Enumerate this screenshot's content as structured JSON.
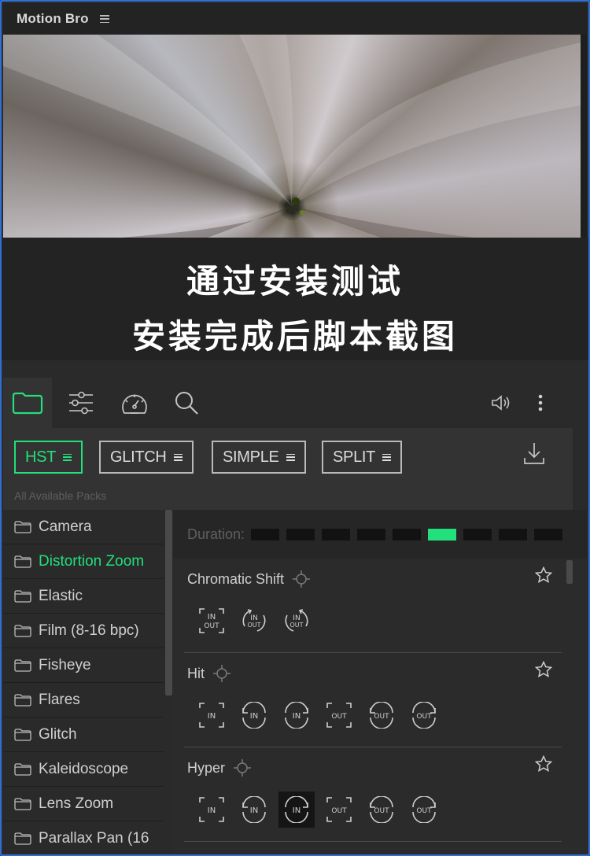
{
  "window": {
    "title": "Motion Bro"
  },
  "banner": {
    "line1": "通过安装测试",
    "line2": "安装完成后脚本截图"
  },
  "toolbar": {
    "tools": [
      "folder-icon",
      "sliders-icon",
      "speedometer-icon",
      "search-icon"
    ],
    "right": [
      "speaker-icon",
      "more-vertical-icon"
    ]
  },
  "packs": {
    "items": [
      {
        "label": "HST",
        "active": true
      },
      {
        "label": "GLITCH",
        "active": false
      },
      {
        "label": "SIMPLE",
        "active": false
      },
      {
        "label": "SPLIT",
        "active": false
      }
    ],
    "caption": "All Available Packs"
  },
  "sidebar": {
    "items": [
      {
        "label": "Camera"
      },
      {
        "label": "Distortion Zoom",
        "active": true
      },
      {
        "label": "Elastic"
      },
      {
        "label": "Film (8-16 bpc)"
      },
      {
        "label": "Fisheye"
      },
      {
        "label": "Flares"
      },
      {
        "label": "Glitch"
      },
      {
        "label": "Kaleidoscope"
      },
      {
        "label": "Lens Zoom"
      },
      {
        "label": "Parallax Pan (16"
      }
    ]
  },
  "duration": {
    "label": "Duration:",
    "segments": 9,
    "selected_index": 5
  },
  "effects": [
    {
      "name": "Chromatic Shift",
      "variants": [
        "IN OUT",
        "IN OUT",
        "IN OUT"
      ]
    },
    {
      "name": "Hit",
      "variants": [
        "IN",
        "IN",
        "IN",
        "OUT",
        "OUT",
        "OUT"
      ]
    },
    {
      "name": "Hyper",
      "variants": [
        "IN",
        "IN",
        "IN",
        "OUT",
        "OUT",
        "OUT"
      ],
      "selected_variant": 2
    }
  ],
  "colors": {
    "accent": "#22e07b",
    "frame": "#2f6fd6",
    "panel": "#2a2a2a"
  }
}
